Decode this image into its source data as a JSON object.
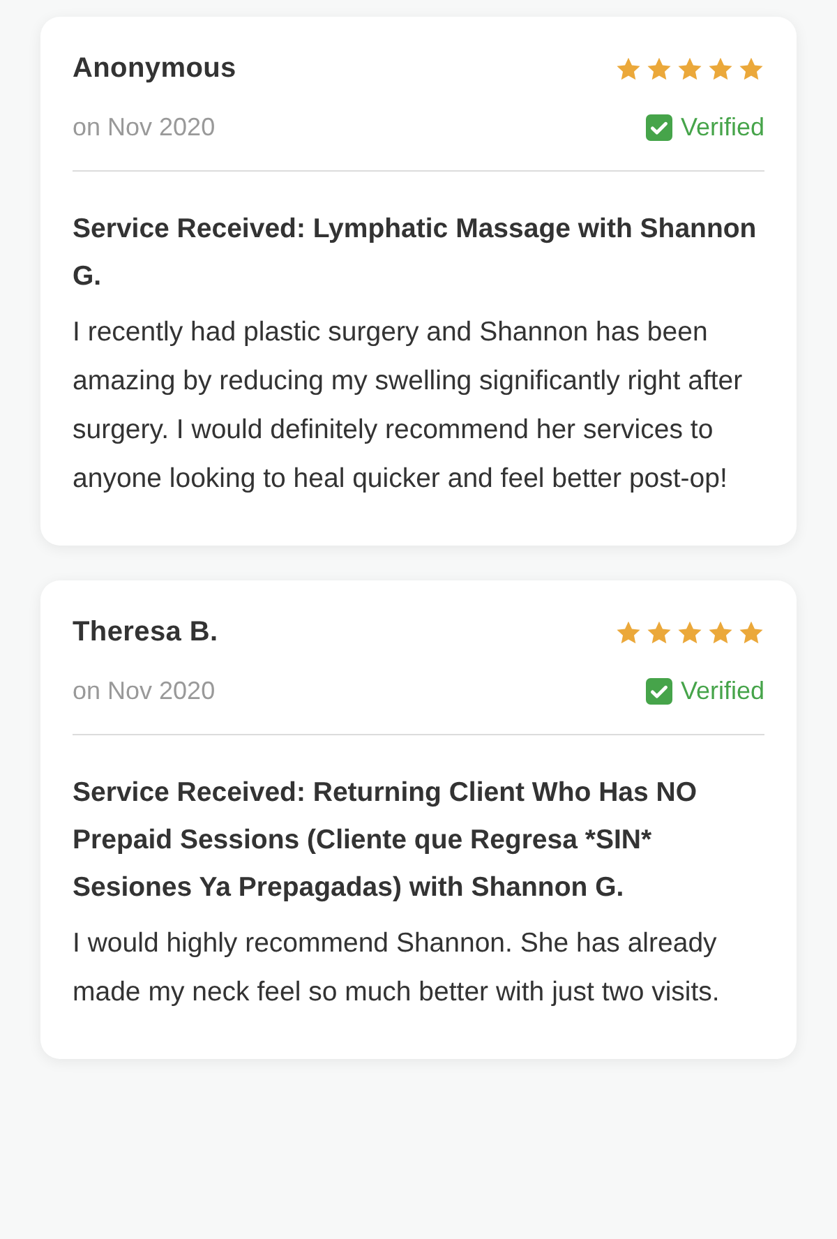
{
  "reviews": [
    {
      "author": "Anonymous",
      "stars": 5,
      "date": "on Nov 2020",
      "verified": true,
      "verified_label": "Verified",
      "service": "Service Received: Lymphatic Massage with Shannon G.",
      "body": "I recently had plastic surgery and Shannon has been amazing by reducing my swelling significantly right after surgery. I would definitely recommend her services to anyone looking to heal quicker and feel better post-op!"
    },
    {
      "author": "Theresa B.",
      "stars": 5,
      "date": "on Nov 2020",
      "verified": true,
      "verified_label": "Verified",
      "service": "Service Received: Returning Client Who Has NO Prepaid Sessions (Cliente que Regresa *SIN* Sesiones Ya Prepagadas) with Shannon G.",
      "body": "I would highly recommend Shannon. She has already made my neck feel so much better with just two visits."
    }
  ]
}
